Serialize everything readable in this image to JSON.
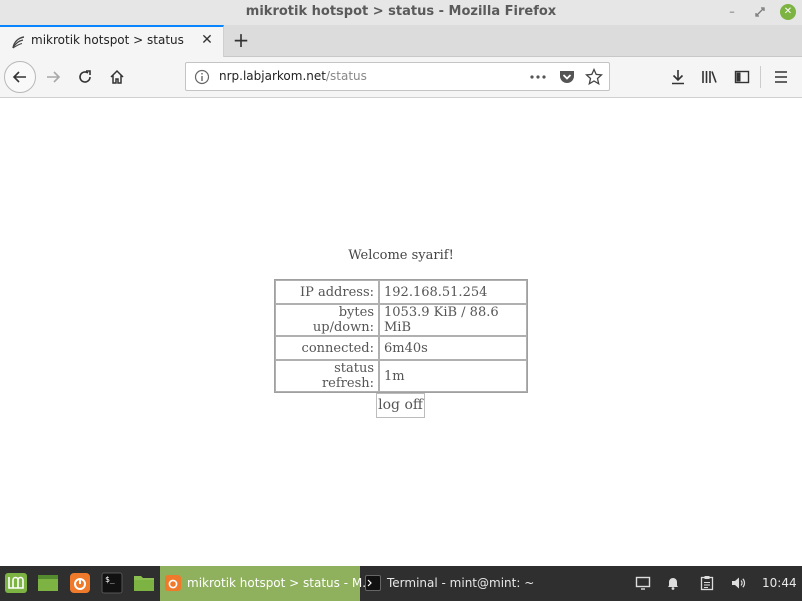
{
  "window": {
    "title": "mikrotik hotspot > status - Mozilla Firefox"
  },
  "tabs": [
    {
      "title": "mikrotik hotspot > status",
      "icon": "hotspot-favicon-icon"
    }
  ],
  "navbar": {
    "url_host": "nrp.labjarkom.net",
    "url_path": "/status"
  },
  "page": {
    "welcome": "Welcome syarif!",
    "rows": [
      {
        "label": "IP address:",
        "value": "192.168.51.254"
      },
      {
        "label": "bytes up/down:",
        "value": "1053.9 KiB / 88.6 MiB"
      },
      {
        "label": "connected:",
        "value": "6m40s"
      },
      {
        "label": "status refresh:",
        "value": "1m"
      }
    ],
    "logoff_label": "log off"
  },
  "taskbar": {
    "tasks": [
      {
        "label": "mikrotik hotspot > status - M...",
        "icon": "firefox-icon",
        "active": true
      },
      {
        "label": "Terminal - mint@mint: ~",
        "icon": "terminal-icon",
        "active": false
      }
    ],
    "clock": "10:44"
  },
  "colors": {
    "accent_blue": "#0a84ff",
    "taskbar_bg": "#2f2f2f",
    "active_task_bg": "#8fb15e",
    "mint_green": "#7cb342",
    "firefox_orange": "#f07a2b"
  }
}
